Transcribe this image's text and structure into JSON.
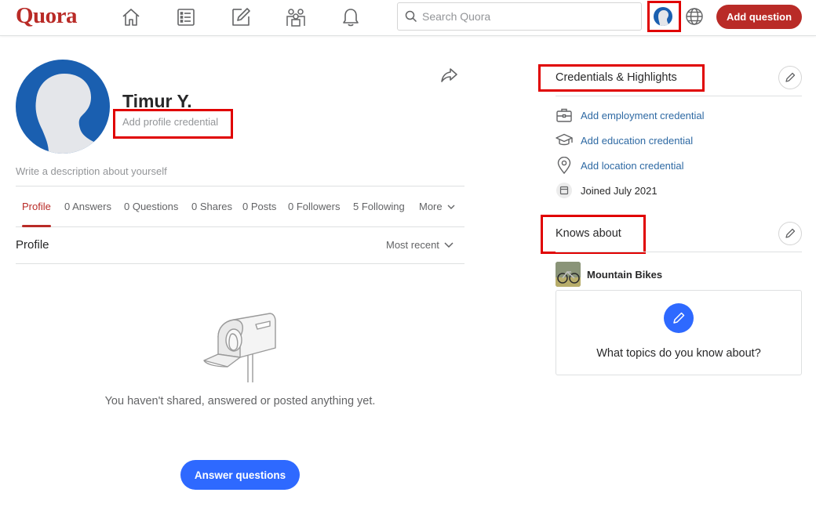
{
  "header": {
    "logo": "Quora",
    "search_placeholder": "Search Quora",
    "add_question_label": "Add question"
  },
  "profile": {
    "name": "Timur Y.",
    "credential_placeholder": "Add profile credential",
    "description_placeholder": "Write a description about yourself"
  },
  "tabs": [
    {
      "label": "Profile",
      "active": true
    },
    {
      "label": "0 Answers"
    },
    {
      "label": "0 Questions"
    },
    {
      "label": "0 Shares"
    },
    {
      "label": "0 Posts"
    },
    {
      "label": "0 Followers"
    },
    {
      "label": "5 Following"
    },
    {
      "label": "More"
    }
  ],
  "section": {
    "title": "Profile",
    "sort_label": "Most recent"
  },
  "empty_state": {
    "message": "You haven't shared, answered or posted anything yet.",
    "button_label": "Answer questions"
  },
  "credentials": {
    "title": "Credentials & Highlights",
    "items": [
      {
        "icon": "briefcase-icon",
        "label": "Add employment credential"
      },
      {
        "icon": "graduation-cap-icon",
        "label": "Add education credential"
      },
      {
        "icon": "location-pin-icon",
        "label": "Add location credential"
      },
      {
        "icon": "calendar-icon",
        "label": "Joined July 2021"
      }
    ]
  },
  "knows_about": {
    "title": "Knows about",
    "topic": "Mountain Bikes",
    "prompt": "What topics do you know about?"
  },
  "colors": {
    "brand": "#b92b27",
    "accent_blue": "#2e69ff",
    "link": "#2e69a3",
    "annotation_red": "#e00000"
  }
}
